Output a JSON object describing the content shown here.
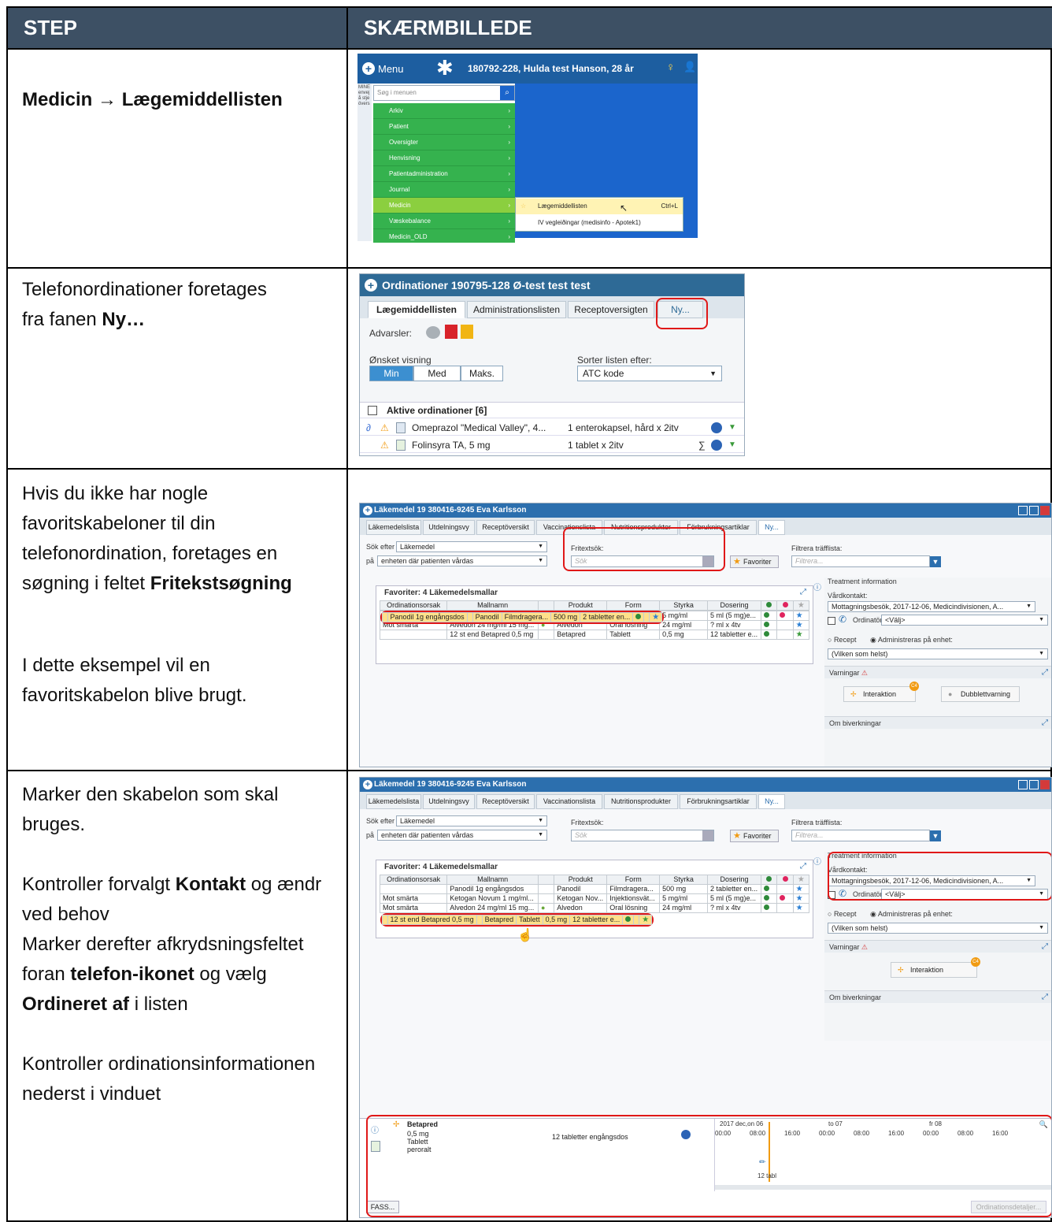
{
  "header": {
    "col_step": "STEP",
    "col_screenshot": "SKÆRMBILLEDE"
  },
  "steps": [
    {
      "a": "Medicin",
      "arrow": "→",
      "b": "Lægemiddellisten"
    },
    {
      "line1": "Telefonordinationer foretages",
      "line2_pre": "fra fanen ",
      "line2_bold": "Ny…"
    },
    {
      "p1": "Hvis du ikke har nogle favoritskabeloner til din telefonordination, foretages en søgning i feltet",
      "p1_bold": "Fritekstsøgning",
      "p2": "I dette eksempel vil en favoritskabelon blive brugt."
    },
    {
      "p1": "Marker den skabelon som skal bruges.",
      "p2_a": "Kontroller forvalgt ",
      "p2_b": "Kontakt",
      "p2_c": " og ændr ved behov",
      "p3_a": "Marker derefter afkrydsningsfeltet foran ",
      "p3_b": "telefon-ikonet",
      "p3_c": " og vælg ",
      "p3_d": "Ordineret af",
      "p3_e": " i listen",
      "p4": "Kontroller ordinationsinformationen nederst i vinduet"
    }
  ],
  "shot1": {
    "menu_label": "Menu",
    "patient": "180792-228, Hulda test Hanson, 28 år",
    "side_text": "MINE envej å stje övers",
    "search_placeholder": "Søg i menuen",
    "items": [
      "Arkiv",
      "Patient",
      "Oversigter",
      "Henvisning",
      "Patientadministration",
      "Journal",
      "Medicin",
      "Væskebalance",
      "Medicin_OLD"
    ],
    "sub_items": [
      "Lægemiddellisten",
      "IV vegleiðingar (medisinfo - Apotek1)"
    ],
    "shortcut": "Ctrl+L"
  },
  "shot2": {
    "title": "Ordinationer 190795-128 Ø-test test test",
    "tabs": [
      "Lægemiddellisten",
      "Administrationslisten",
      "Receptoversigten",
      "Ny..."
    ],
    "warnings_label": "Advarsler:",
    "view_label": "Ønsket visning",
    "view_options": [
      "Min",
      "Med",
      "Maks."
    ],
    "sort_label": "Sorter listen efter:",
    "sort_value": "ATC kode",
    "active_header": "Aktive ordinationer [6]",
    "rows": [
      {
        "name": "Omeprazol \"Medical Valley\", 4...",
        "dose": "1 enterokapsel, hård x 2itv"
      },
      {
        "name": "Folinsyra TA, 5 mg",
        "dose": "1 tablet x 2itv"
      }
    ]
  },
  "shot3": {
    "title": "Läkemedel 19 380416-9245 Eva Karlsson",
    "tabs": [
      "Läkemedelslista",
      "Utdelningsvy",
      "Receptöversikt",
      "Vaccinationslista",
      "Nutritionsprodukter",
      "Förbrukningsartiklar",
      "Ny..."
    ],
    "search_for_label": "Sök efter",
    "search_for_value": "Läkemedel",
    "on_label": "på",
    "on_value": "enheten där patienten vårdas",
    "freetext_label": "Fritextsök:",
    "freetext_placeholder": "Sök",
    "favorites_button": "Favoriter",
    "filter_label": "Filtrera träfflista:",
    "filter_placeholder": "Filtrera...",
    "fav_header": "Favoriter: 4 Läkemedelsmallar",
    "table_head": [
      "Ordinationsorsak",
      "Mallnamn",
      "",
      "Produkt",
      "Form",
      "Styrka",
      "Dosering"
    ],
    "table_rows": [
      [
        "",
        "Panodil 1g engångsdos",
        "",
        "Panodil",
        "Filmdragera...",
        "500 mg",
        "2 tabletter en..."
      ],
      [
        "Mot smärta",
        "Ketogan Novum 1 mg/ml...",
        "",
        "Ketogan Nov...",
        "Injektionsvät...",
        "5 mg/ml",
        "5 ml (5 mg)e..."
      ],
      [
        "Mot smärta",
        "Alvedon 24 mg/ml 15 mg...",
        "",
        "Alvedon",
        "Oral lösning",
        "24 mg/ml",
        "? ml x 4tv"
      ],
      [
        "",
        "12 st end Betapred 0,5 mg",
        "",
        "Betapred",
        "Tablett",
        "0,5 mg",
        "12 tabletter e..."
      ]
    ],
    "treatment_info": "Treatment information",
    "vardkontakt_label": "Vårdkontakt:",
    "vardkontakt_value": "Mottagningsbesök, 2017-12-06, Medicindivisionen, A...",
    "ordinator_label": "Ordinatör:",
    "ordinator_value": "<Välj>",
    "radio_recept": "Recept",
    "radio_admin": "Administreras på enhet:",
    "unit_value": "(Vilken som helst)",
    "varningar": "Varningar",
    "interaktion": "Interaktion",
    "dubblett": "Dubblettvarning",
    "badge": "C4",
    "biverkningar": "Om biverkningar"
  },
  "shot4": {
    "drug": "Betapred",
    "details": [
      "0,5 mg",
      "Tablett",
      "peroralt"
    ],
    "dose_text": "12 tabletter  engångsdos",
    "tl_head": [
      "2017 dec,on 06",
      "to 07",
      "fr 08"
    ],
    "tl_times": [
      "00:00",
      "08:00",
      "16:00",
      "00:00",
      "08:00",
      "16:00",
      "00:00",
      "08:00",
      "16:00"
    ],
    "tl_mark": "12 tabl",
    "fass": "FASS...",
    "ord_details": "Ordinationsdetaljer..."
  }
}
